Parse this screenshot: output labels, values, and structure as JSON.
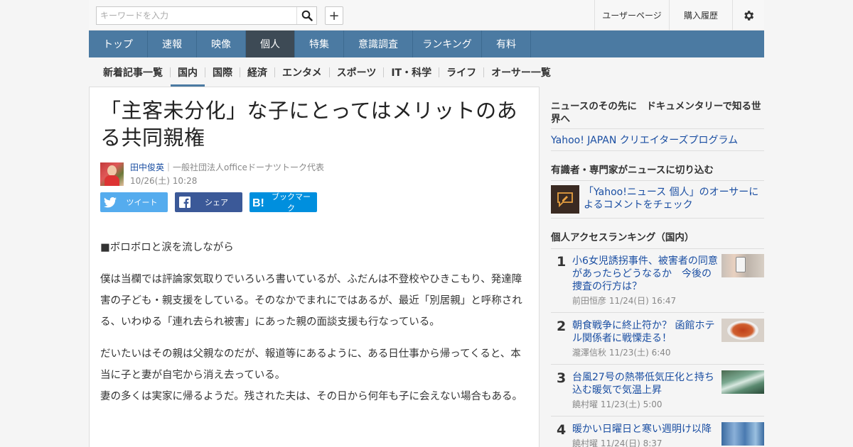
{
  "header": {
    "search_placeholder": "キーワードを入力",
    "plus_label": "+",
    "user_page": "ユーザーページ",
    "purchase_history": "購入履歴"
  },
  "main_nav": [
    {
      "label": "トップ",
      "active": false
    },
    {
      "label": "速報",
      "active": false
    },
    {
      "label": "映像",
      "active": false
    },
    {
      "label": "個人",
      "active": true
    },
    {
      "label": "特集",
      "active": false
    },
    {
      "label": "意識調査",
      "active": false
    },
    {
      "label": "ランキング",
      "active": false
    },
    {
      "label": "有料",
      "active": false
    }
  ],
  "sub_nav": [
    {
      "label": "新着記事一覧",
      "active": false
    },
    {
      "label": "国内",
      "active": true
    },
    {
      "label": "国際",
      "active": false
    },
    {
      "label": "経済",
      "active": false
    },
    {
      "label": "エンタメ",
      "active": false
    },
    {
      "label": "スポーツ",
      "active": false
    },
    {
      "label": "IT・科学",
      "active": false
    },
    {
      "label": "ライフ",
      "active": false
    },
    {
      "label": "オーサー一覧",
      "active": false
    }
  ],
  "article": {
    "title": "「主客未分化」な子にとってはメリットのある共同親権",
    "author_name": "田中俊英",
    "author_role": "｜一般社団法人officeドーナツトーク代表",
    "date": "10/26(土) 10:28",
    "share": {
      "tweet": "ツイート",
      "facebook": "シェア",
      "hatena": "ブックマーク"
    },
    "paragraphs": [
      "■ボロボロと涙を流しながら",
      "僕は当欄では評論家気取りでいろいろ書いているが、ふだんは不登校やひきこもり、発達障害の子ども・親支援をしている。そのなかでまれにではあるが、最近「別居親」と呼称される、いわゆる「連れ去られ被害」にあった親の面談支援も行なっている。",
      "だいたいはその親は父親なのだが、報道等にあるように、ある日仕事から帰ってくると、本当に子と妻が自宅から消え去っている。",
      "妻の多くは実家に帰るようだ。残された夫は、その日から何年も子に会えない場合もある。"
    ]
  },
  "sidebar": {
    "doc_heading": "ニュースのその先に　ドキュメンタリーで知る世界へ",
    "creators_link": "Yahoo! JAPAN クリエイターズプログラム",
    "expert_heading": "有識者・専門家がニュースに切り込む",
    "expert_link": "「Yahoo!ニュース 個人」のオーサーによるコメントをチェック",
    "ranking_heading": "個人アクセスランキング（国内）",
    "ranking": [
      {
        "rank": "1",
        "title": "小6女児誘拐事件、被害者の同意があったらどうなるか　今後の捜査の行方は？",
        "author": "前田恒彦",
        "date": "11/24(日) 16:47"
      },
      {
        "rank": "2",
        "title": "朝食戦争に終止符か？ 函館ホテル関係者に戦慄走る！",
        "author": "瀧澤信秋",
        "date": "11/23(土) 6:40"
      },
      {
        "rank": "3",
        "title": "台風27号の熱帯低気圧化と持ち込む暖気で気温上昇",
        "author": "饒村曜",
        "date": "11/23(土) 5:00"
      },
      {
        "rank": "4",
        "title": "暖かい日曜日と寒い週明け以降",
        "author": "饒村曜",
        "date": "11/24(日) 8:37"
      }
    ]
  },
  "colors": {
    "nav_bg": "#4b7aa2",
    "nav_active": "#3d4a55",
    "link": "#1a4ea2",
    "twitter": "#55acee",
    "facebook": "#3b5998",
    "hatena": "#008fde"
  }
}
